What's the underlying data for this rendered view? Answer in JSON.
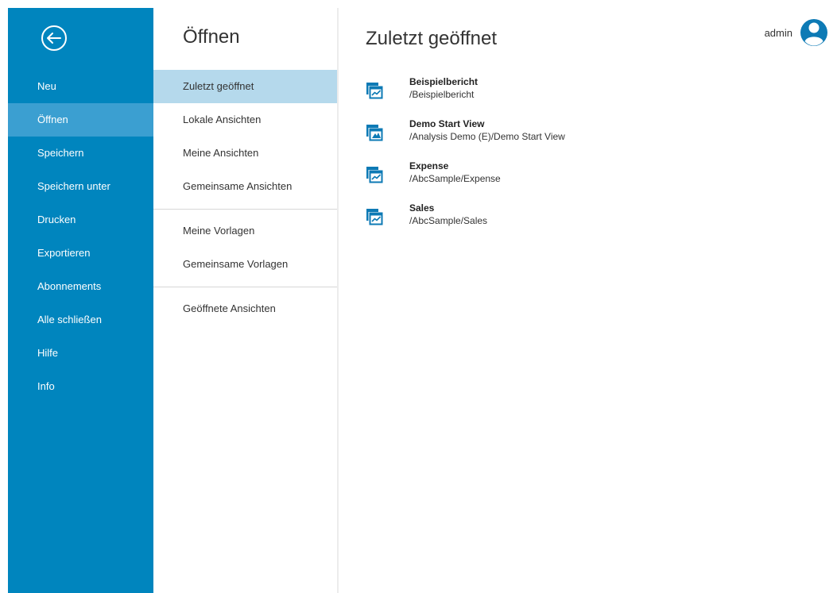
{
  "colors": {
    "nav_bg": "#0085be",
    "nav_active": "#3b9fd1",
    "sub_active": "#b5d9ec",
    "accent": "#0d7ab5"
  },
  "nav": {
    "back_icon": "back-arrow-circle-icon",
    "items": [
      {
        "label": "Neu"
      },
      {
        "label": "Öffnen",
        "active": true
      },
      {
        "label": "Speichern"
      },
      {
        "label": "Speichern unter"
      },
      {
        "label": "Drucken"
      },
      {
        "label": "Exportieren"
      },
      {
        "label": "Abonnements"
      },
      {
        "label": "Alle schließen"
      },
      {
        "label": "Hilfe"
      },
      {
        "label": "Info"
      }
    ]
  },
  "submenu": {
    "title": "Öffnen",
    "groups": [
      [
        "Zuletzt geöffnet",
        "Lokale Ansichten",
        "Meine Ansichten",
        "Gemeinsame Ansichten"
      ],
      [
        "Meine Vorlagen",
        "Gemeinsame Vorlagen"
      ],
      [
        "Geöffnete Ansichten"
      ]
    ],
    "active": "Zuletzt geöffnet"
  },
  "main": {
    "title": "Zuletzt geöffnet",
    "items": [
      {
        "name": "Beispielbericht",
        "path": "/Beispielbericht",
        "icon": "report-chart-icon"
      },
      {
        "name": "Demo Start View",
        "path": "/Analysis Demo (E)/Demo Start View",
        "icon": "analysis-view-icon"
      },
      {
        "name": "Expense",
        "path": "/AbcSample/Expense",
        "icon": "report-chart-icon"
      },
      {
        "name": "Sales",
        "path": "/AbcSample/Sales",
        "icon": "report-chart-icon"
      }
    ]
  },
  "user": {
    "name": "admin",
    "icon": "user-avatar-icon"
  }
}
